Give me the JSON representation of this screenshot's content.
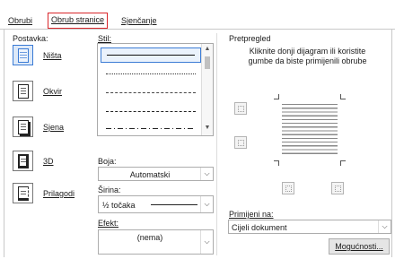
{
  "tabs": [
    {
      "label": "Obrubi",
      "active": false
    },
    {
      "label": "Obrub stranice",
      "active": true
    },
    {
      "label": "Sjenčanje",
      "active": false
    }
  ],
  "setting": {
    "label": "Postavka:",
    "items": [
      {
        "label": "Ništa",
        "icon": "preset-none-icon",
        "selected": true
      },
      {
        "label": "Okvir",
        "icon": "preset-box-icon",
        "selected": false
      },
      {
        "label": "Sjena",
        "icon": "preset-shadow-icon",
        "selected": false
      },
      {
        "label": "3D",
        "icon": "preset-3d-icon",
        "selected": false
      },
      {
        "label": "Prilagodi",
        "icon": "preset-custom-icon",
        "selected": false
      }
    ]
  },
  "style": {
    "label": "Stil:",
    "options": [
      "solid",
      "dotted",
      "dashed-fine",
      "dashed",
      "dash-dot"
    ]
  },
  "color": {
    "label": "Boja:",
    "value": "Automatski"
  },
  "width": {
    "label": "Širina:",
    "value": "½ točaka"
  },
  "art": {
    "label": "Efekt:",
    "value": "(nema)"
  },
  "preview": {
    "label": "Pretpregled",
    "hint": "Kliknite donji dijagram ili koristite gumbe da biste primijenili obrube"
  },
  "apply_to": {
    "label": "Primijeni na:",
    "value": "Cijeli dokument"
  },
  "options_button": "Mogućnosti...",
  "colors": {
    "accent": "#3a7bd5",
    "tab_highlight": "#d9262b"
  }
}
